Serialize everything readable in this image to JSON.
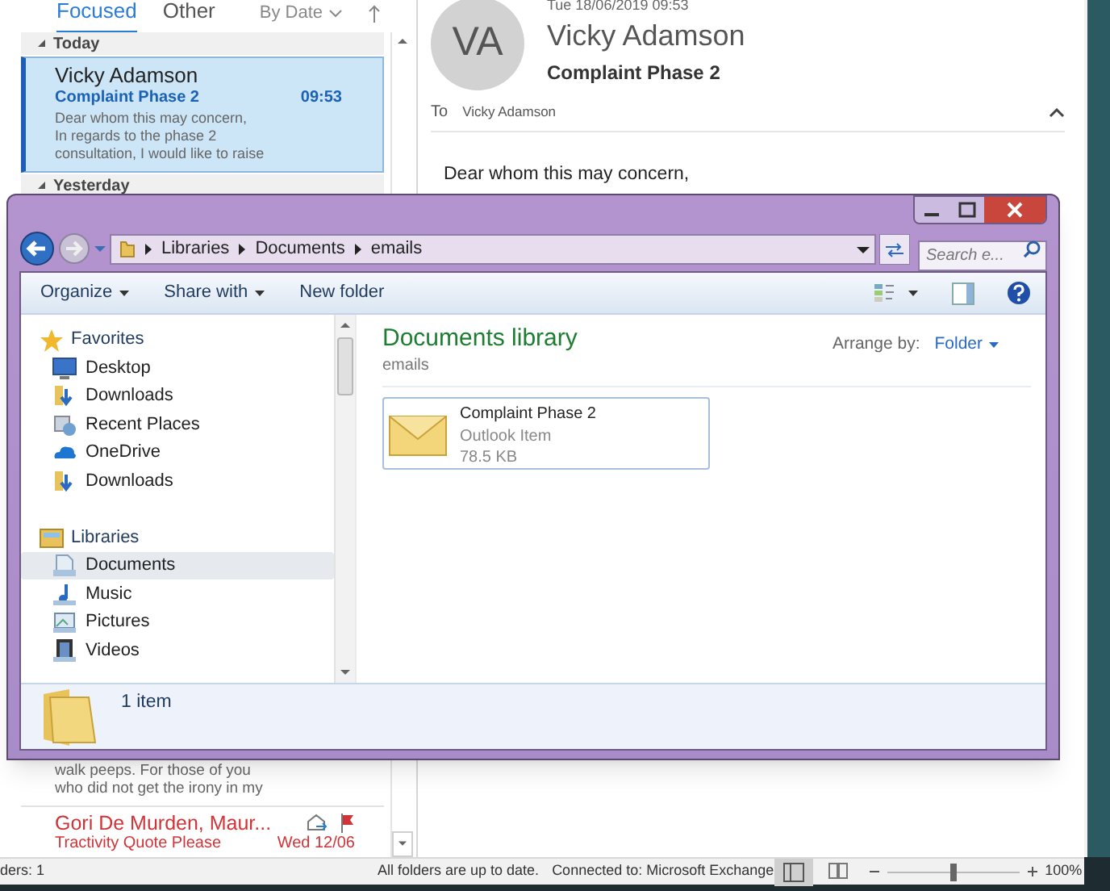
{
  "mail_list": {
    "tabs": [
      {
        "label": "Focused",
        "selected": true
      },
      {
        "label": "Other",
        "selected": false
      }
    ],
    "sort": "By Date",
    "groups": [
      "Today",
      "Yesterday"
    ],
    "selected_message": {
      "sender": "Vicky Adamson",
      "subject": "Complaint Phase 2",
      "time": "09:53",
      "preview": "Dear whom this may concern,\nIn regards to the phase 2\nconsultation, I would like to raise"
    },
    "partial_preview": "walk peeps.  For those of you\nwho did not get the irony in my",
    "next_message": {
      "sender": "Gori De Murden, Maur...",
      "subject": "Tractivity Quote Please",
      "date": "Wed 12/06",
      "unread": true,
      "flagged": true
    }
  },
  "reading_pane": {
    "date": "Tue 18/06/2019 09:53",
    "initials": "VA",
    "sender": "Vicky Adamson",
    "subject": "Complaint Phase 2",
    "to_label": "To",
    "to": "Vicky Adamson",
    "body": "Dear whom this may concern,"
  },
  "explorer": {
    "breadcrumb": [
      "Libraries",
      "Documents",
      "emails"
    ],
    "search": {
      "placeholder": "Search e..."
    },
    "toolbar": [
      {
        "label": "Organize",
        "dropdown": true
      },
      {
        "label": "Share with",
        "dropdown": true
      },
      {
        "label": "New folder",
        "dropdown": false
      }
    ],
    "nav": [
      {
        "label": "Favorites",
        "items": [
          {
            "label": "Desktop",
            "selected": false
          },
          {
            "label": "Downloads",
            "selected": false
          },
          {
            "label": "Recent Places",
            "selected": false
          },
          {
            "label": "OneDrive",
            "selected": false
          },
          {
            "label": "Downloads",
            "selected": false
          }
        ]
      },
      {
        "label": "Libraries",
        "items": [
          {
            "label": "Documents",
            "selected": true
          },
          {
            "label": "Music",
            "selected": false
          },
          {
            "label": "Pictures",
            "selected": false
          },
          {
            "label": "Videos",
            "selected": false
          }
        ]
      }
    ],
    "title": "Documents library",
    "subtitle": "emails",
    "arrange_label": "Arrange by:",
    "arrange_value": "Folder",
    "files": [
      {
        "name": "Complaint Phase 2",
        "type": "Outlook Item",
        "size": "78.5 KB"
      }
    ],
    "details": "1 item"
  },
  "status_bar": {
    "left": "ders: 1",
    "sync": "All folders are up to date.",
    "connection": "Connected to: Microsoft Exchange",
    "zoom": {
      "level": 0.5,
      "reading": "100%"
    }
  }
}
